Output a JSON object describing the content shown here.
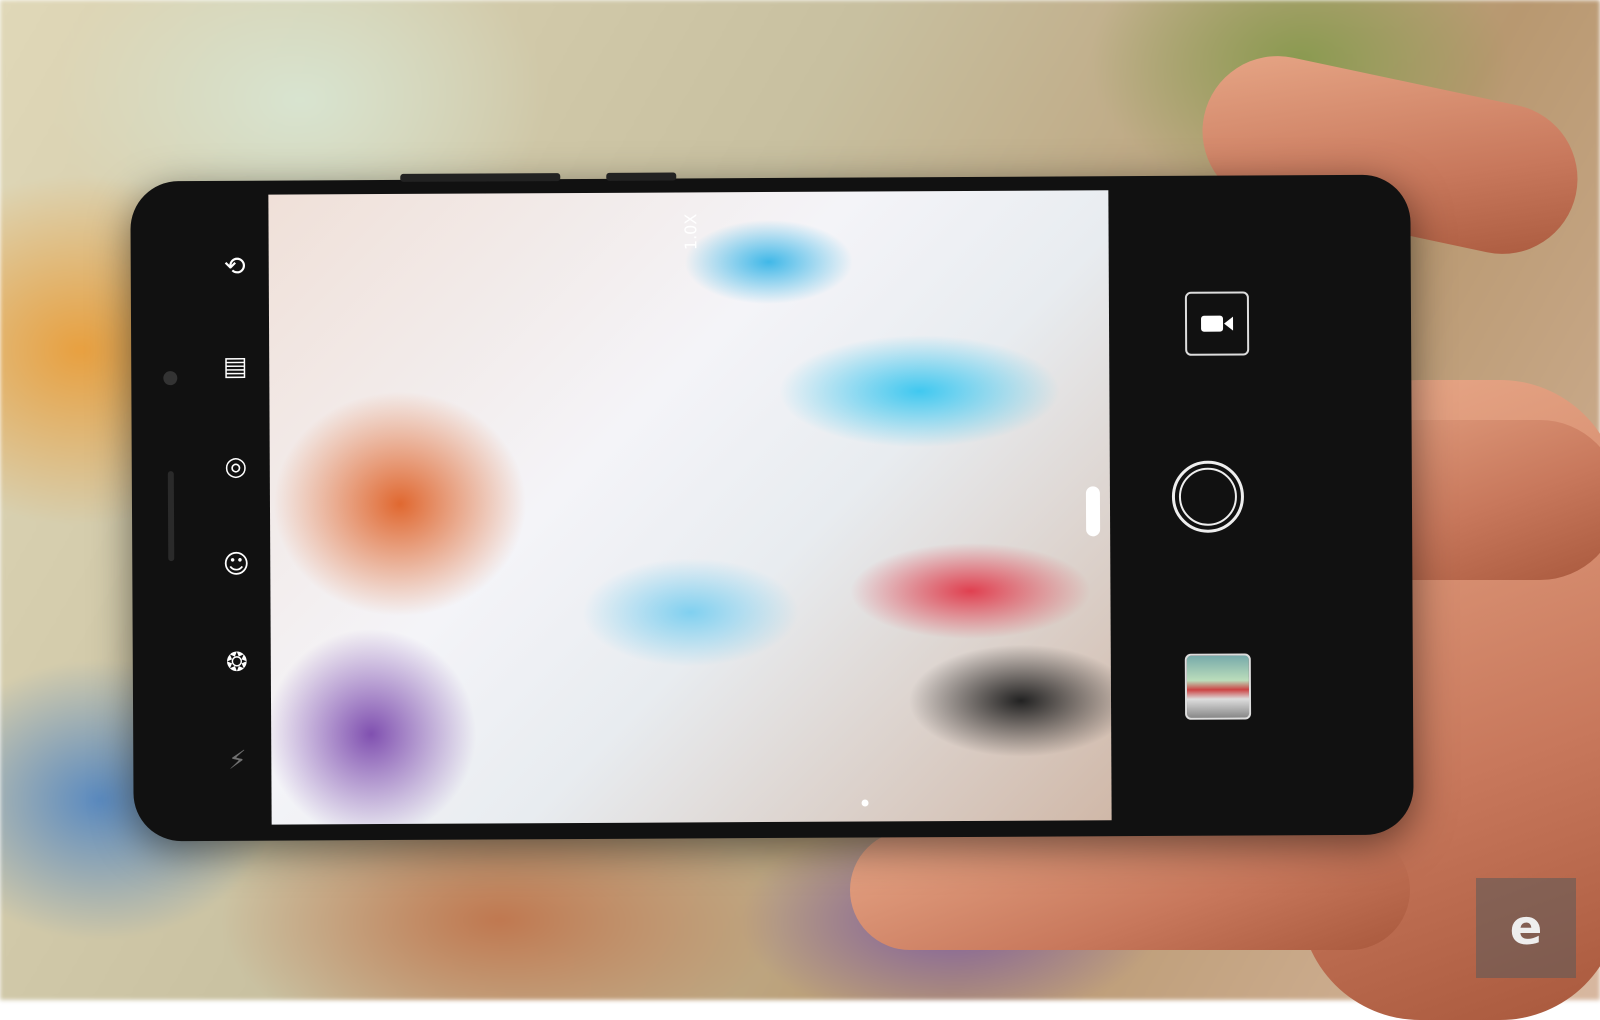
{
  "camera": {
    "zoom_label": "1.0X",
    "left_bar": [
      {
        "icon": "switch-camera-icon",
        "glyph": "⟲"
      },
      {
        "icon": "film-filter-icon",
        "glyph": "▤"
      },
      {
        "icon": "aperture-mode-icon",
        "glyph": "◎"
      },
      {
        "icon": "portrait-mode-icon",
        "glyph": "☺"
      },
      {
        "icon": "shutter-mode-icon",
        "glyph": "❂"
      },
      {
        "icon": "flash-off-icon",
        "glyph": "⚡"
      }
    ],
    "right_bar": [
      "video-icon",
      "shutter-button",
      "gallery-thumbnail"
    ]
  },
  "watermark": "e"
}
